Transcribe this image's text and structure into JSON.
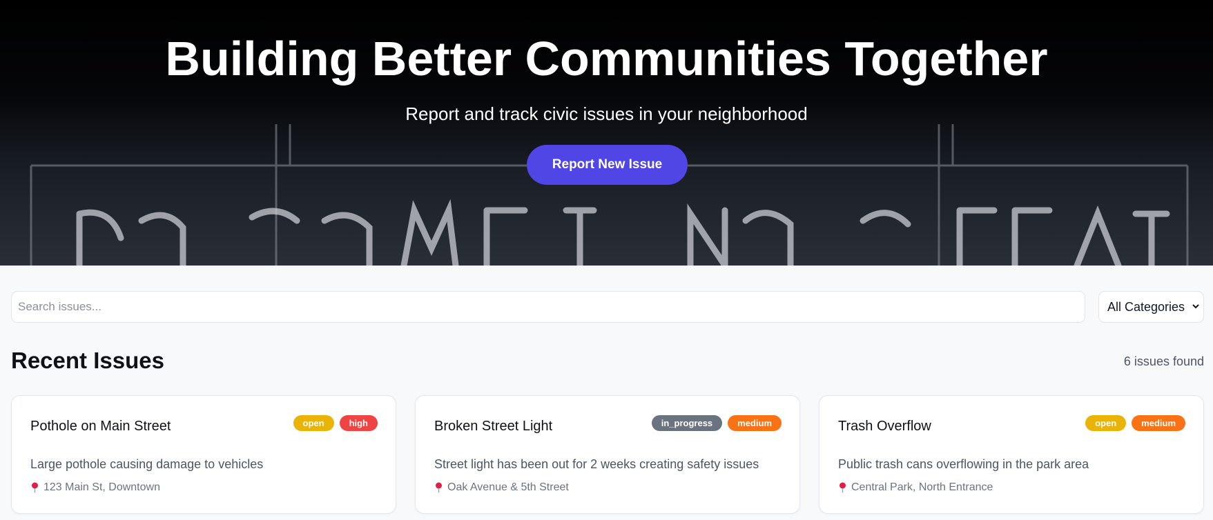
{
  "hero": {
    "title": "Building Better Communities Together",
    "subtitle": "Report and track civic issues in your neighborhood",
    "cta_label": "Report New Issue"
  },
  "search": {
    "placeholder": "Search issues...",
    "category_selected": "All Categories"
  },
  "section": {
    "title": "Recent Issues",
    "count_text": "6 issues found"
  },
  "status_colors": {
    "open": "#eab308",
    "in_progress": "#6b7280",
    "high": "#ef4444",
    "medium": "#f97316"
  },
  "accent_color": "#4f46e5",
  "issues": [
    {
      "title": "Pothole on Main Street",
      "status": "open",
      "priority": "high",
      "description": "Large pothole causing damage to vehicles",
      "location": "123 Main St, Downtown",
      "location_icon": "map-pin-icon"
    },
    {
      "title": "Broken Street Light",
      "status": "in_progress",
      "priority": "medium",
      "description": "Street light has been out for 2 weeks creating safety issues",
      "location": "Oak Avenue & 5th Street",
      "location_icon": "map-pin-icon"
    },
    {
      "title": "Trash Overflow",
      "status": "open",
      "priority": "medium",
      "description": "Public trash cans overflowing in the park area",
      "location": "Central Park, North Entrance",
      "location_icon": "map-pin-icon"
    }
  ]
}
